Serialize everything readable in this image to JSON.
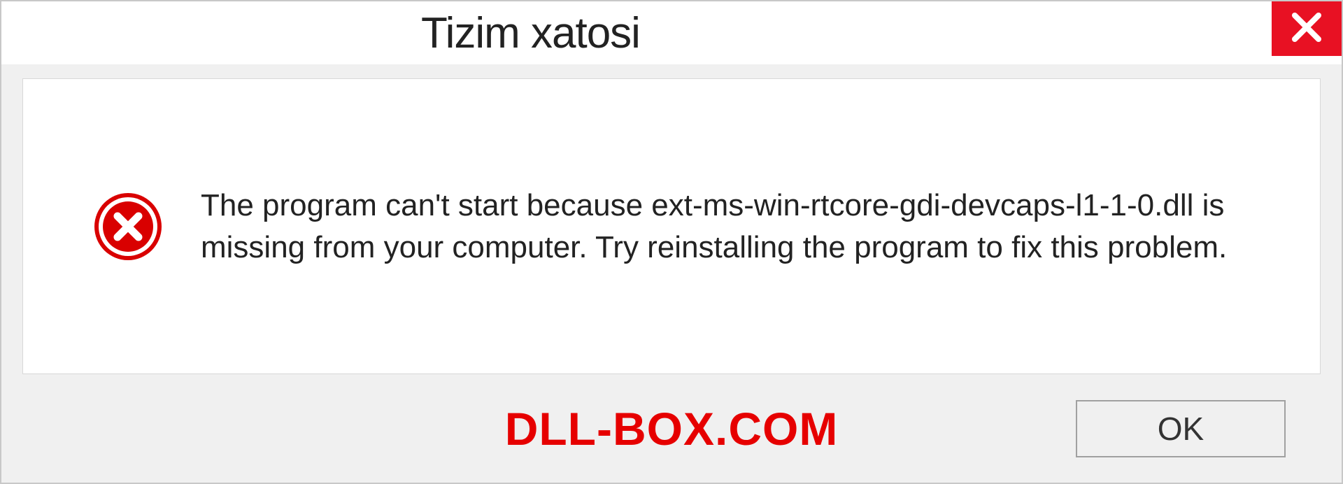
{
  "titlebar": {
    "title": "Tizim xatosi"
  },
  "message": {
    "text": "The program can't start because ext-ms-win-rtcore-gdi-devcaps-l1-1-0.dll is missing from your computer. Try reinstalling the program to fix this problem."
  },
  "footer": {
    "watermark": "DLL-BOX.COM",
    "ok_label": "OK"
  }
}
